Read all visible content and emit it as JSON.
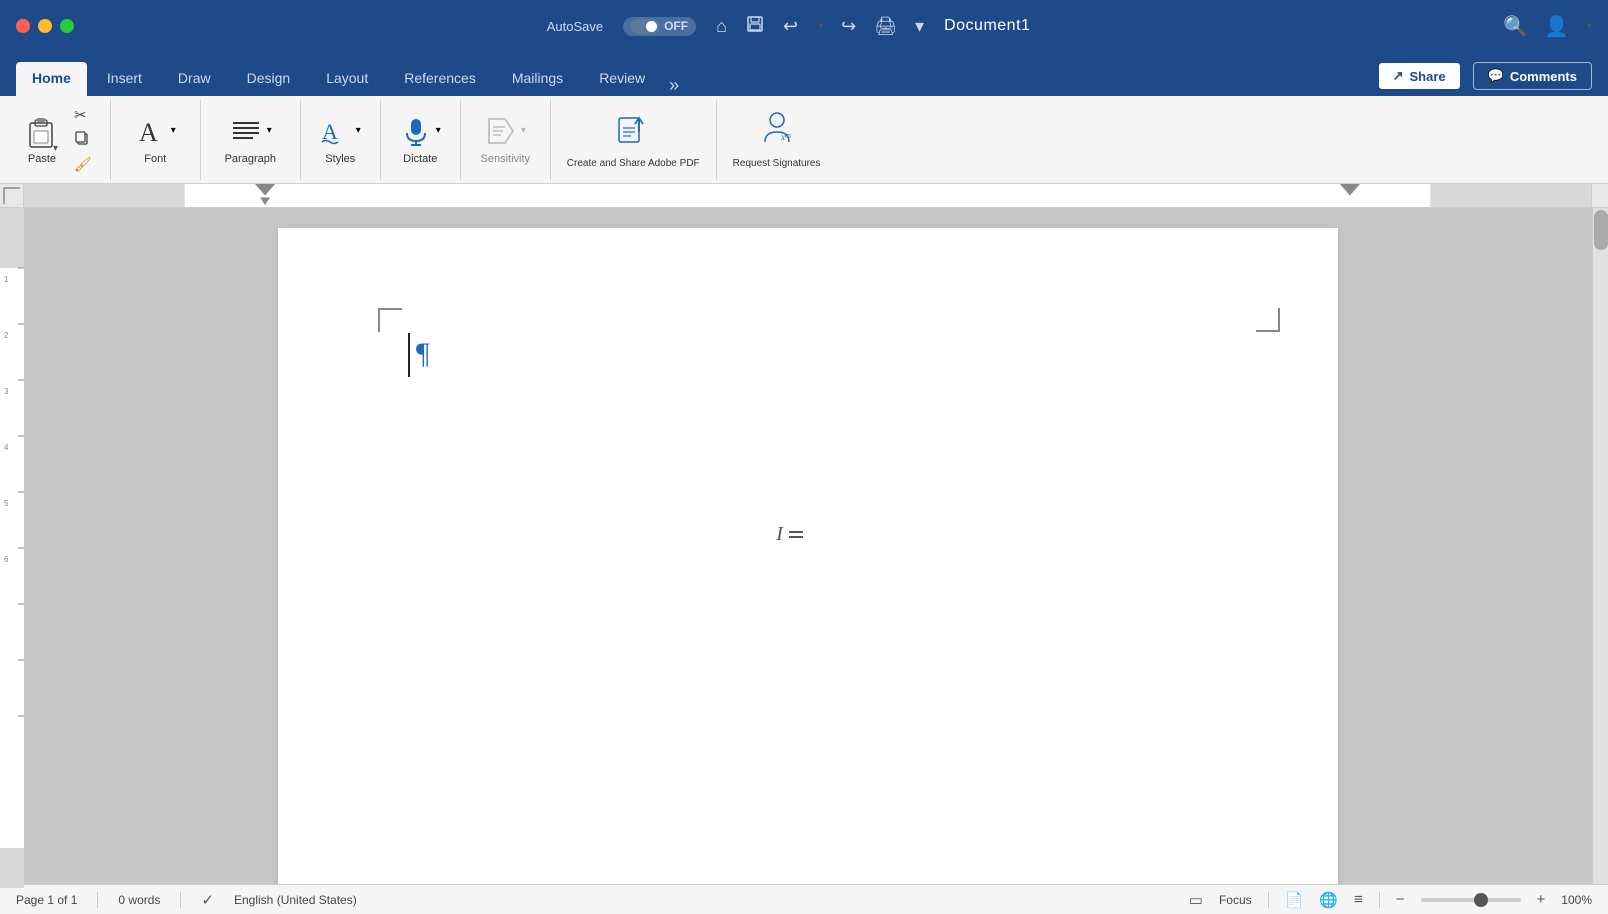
{
  "titleBar": {
    "autosave": "AutoSave",
    "toggleState": "OFF",
    "title": "Document1",
    "icons": [
      "home",
      "save",
      "undo",
      "undo-dropdown",
      "redo",
      "print",
      "customize"
    ]
  },
  "ribbonTabs": {
    "tabs": [
      {
        "label": "Home",
        "active": true
      },
      {
        "label": "Insert",
        "active": false
      },
      {
        "label": "Draw",
        "active": false
      },
      {
        "label": "Design",
        "active": false
      },
      {
        "label": "Layout",
        "active": false
      },
      {
        "label": "References",
        "active": false
      },
      {
        "label": "Mailings",
        "active": false
      },
      {
        "label": "Review",
        "active": false
      }
    ],
    "shareButton": "Share",
    "commentsButton": "Comments",
    "moreLabel": "»"
  },
  "toolbar": {
    "groups": [
      {
        "name": "clipboard",
        "items": [
          {
            "id": "paste",
            "label": "Paste"
          },
          {
            "id": "cut",
            "label": ""
          },
          {
            "id": "copy",
            "label": ""
          },
          {
            "id": "format-painter",
            "label": ""
          }
        ]
      },
      {
        "name": "font",
        "label": "Font",
        "items": [
          {
            "id": "font",
            "label": "Font"
          }
        ]
      },
      {
        "name": "paragraph",
        "label": "Paragraph",
        "items": [
          {
            "id": "paragraph",
            "label": "Paragraph"
          }
        ]
      },
      {
        "name": "styles",
        "label": "Styles",
        "items": [
          {
            "id": "styles",
            "label": "Styles"
          }
        ]
      },
      {
        "name": "dictate",
        "label": "Dictate",
        "items": [
          {
            "id": "dictate",
            "label": "Dictate"
          }
        ]
      },
      {
        "name": "sensitivity",
        "label": "Sensitivity",
        "items": [
          {
            "id": "sensitivity",
            "label": "Sensitivity"
          }
        ]
      },
      {
        "name": "adobe",
        "label": "Create and Share Adobe PDF",
        "items": []
      },
      {
        "name": "request-signatures",
        "label": "Request Signatures",
        "items": []
      }
    ]
  },
  "statusBar": {
    "page": "Page 1 of 1",
    "words": "0 words",
    "language": "English (United States)",
    "focus": "Focus",
    "zoom": "100%",
    "zoomPercent": 100
  }
}
